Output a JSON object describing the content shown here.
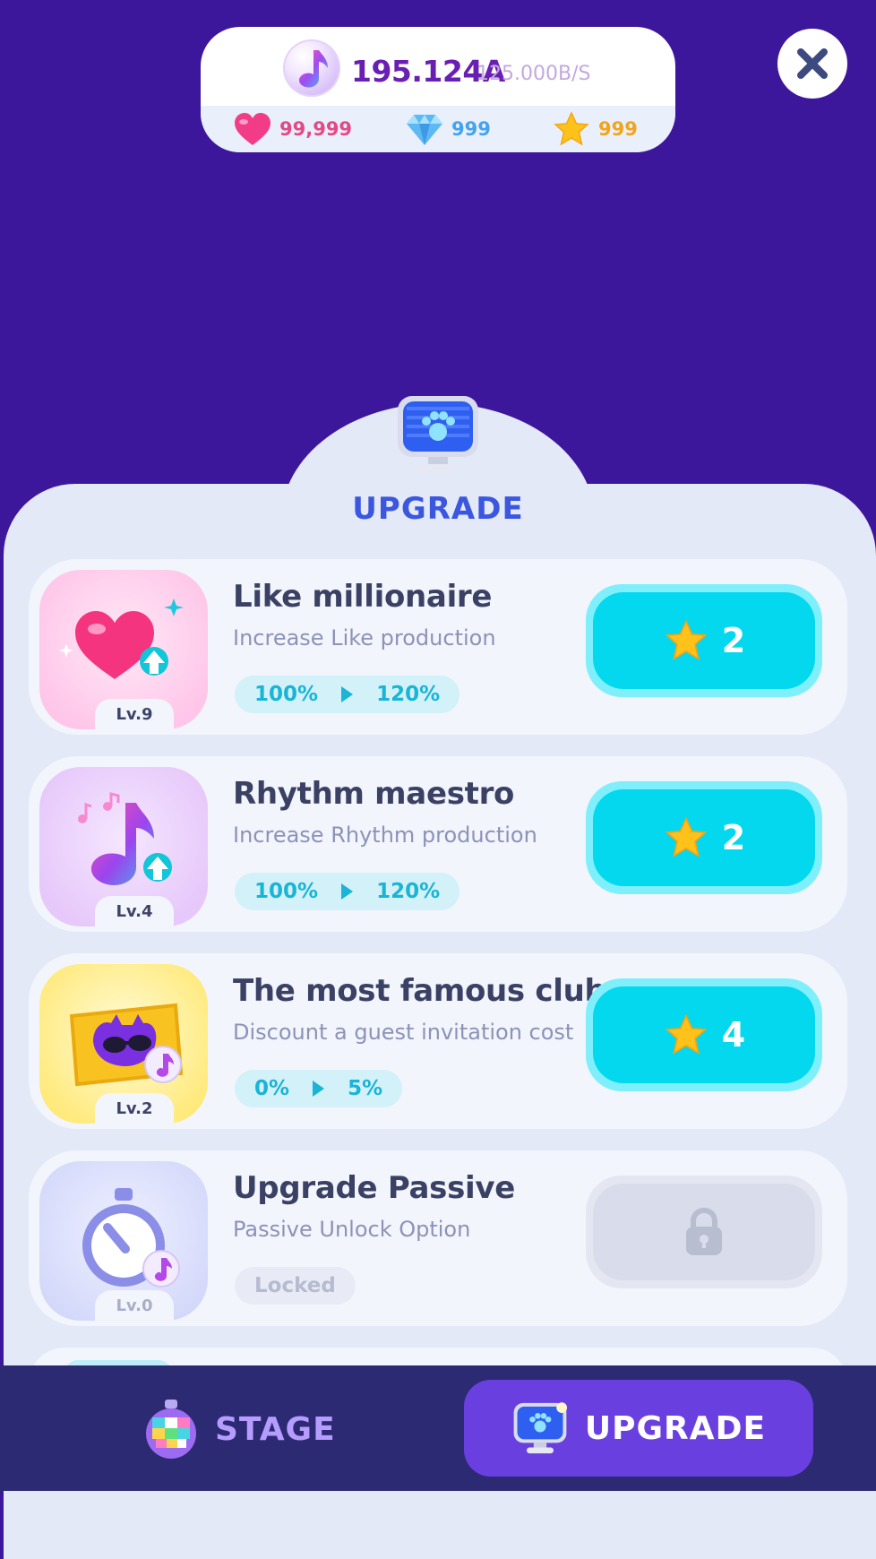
{
  "resources": {
    "music_amount": "195.124A",
    "music_rate": "125.000B/S",
    "hearts": "99,999",
    "gems": "999",
    "stars": "999"
  },
  "panel": {
    "title": "UPGRADE",
    "icon": "paw-monitor-icon"
  },
  "upgrades": [
    {
      "title": "Like millionaire",
      "description": "Increase Like production",
      "level": "Lv.9",
      "from": "100%",
      "to": "120%",
      "cost": "2",
      "cost_icon": "star-icon",
      "thumb_color": "#ffd3ef"
    },
    {
      "title": "Rhythm maestro",
      "description": "Increase Rhythm production",
      "level": "Lv.4",
      "from": "100%",
      "to": "120%",
      "cost": "2",
      "cost_icon": "star-icon",
      "thumb_color": "#ead2fb"
    },
    {
      "title": "The most famous club",
      "description": "Discount a guest invitation cost",
      "level": "Lv.2",
      "from": "0%",
      "to": "5%",
      "cost": "4",
      "cost_icon": "star-icon",
      "thumb_color": "#fff0a0"
    },
    {
      "title": "Upgrade Passive",
      "description": "Passive Unlock Option",
      "level": "Lv.0",
      "status": "Locked",
      "cost_icon": "lock-icon",
      "thumb_color": "#dbe0fb"
    }
  ],
  "bottom_nav": {
    "stage_label": "STAGE",
    "upgrade_label": "UPGRADE",
    "active": "UPGRADE"
  },
  "colors": {
    "background": "#3d179b",
    "panel": "#e4e9f8",
    "buy_button": "#03d8ef",
    "nav": "#2c2a72",
    "nav_active": "#6a3fe0"
  }
}
